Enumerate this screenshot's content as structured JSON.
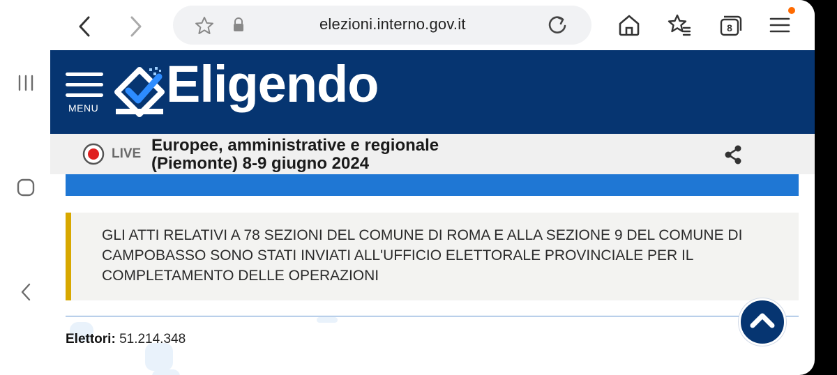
{
  "browser": {
    "url": "elezioni.interno.gov.it",
    "tab_count": "8",
    "accent_dot_color": "#ff6a00"
  },
  "site": {
    "menu_label": "MENU",
    "logo_text": "Eligendo",
    "header_color": "#063571"
  },
  "live": {
    "label": "LIVE",
    "title_line1": "Europee, amministrative e regionale",
    "title_line2": "(Piemonte) 8-9 giugno 2024"
  },
  "notice": {
    "line1": "GLI ATTI RELATIVI A 78 SEZIONI DEL COMUNE DI ROMA E ALLA SEZIONE 9 DEL COMUNE DI",
    "line2": "CAMPOBASSO SONO STATI INVIATI ALL'UFFICIO ELETTORALE PROVINCIALE PER IL",
    "line3": "COMPLETAMENTO DELLE OPERAZIONI",
    "accent_color": "#d8a800"
  },
  "stats": {
    "elettori_label": "Elettori:",
    "elettori_value": "51.214.348"
  },
  "icons": [
    "recents-icon",
    "home-icon",
    "back-icon",
    "chevron-left-icon",
    "chevron-right-icon",
    "star-icon",
    "lock-icon",
    "reload-icon",
    "home-page-icon",
    "bookmarks-icon",
    "tabs-icon",
    "menu-icon",
    "hamburger-icon",
    "eligendo-logo-icon",
    "record-icon",
    "share-icon",
    "chevron-up-icon"
  ]
}
